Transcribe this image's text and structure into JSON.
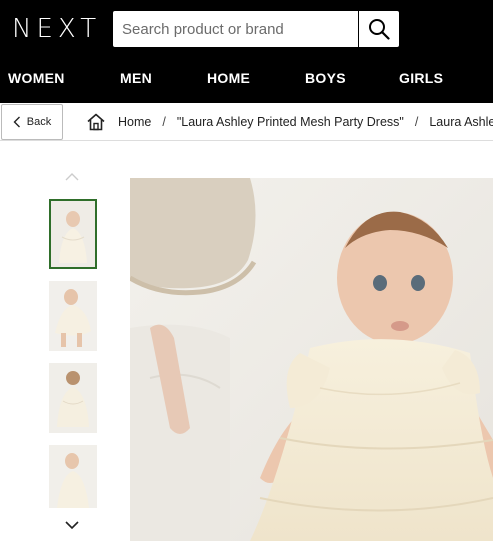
{
  "header": {
    "logo_text": "NEXT",
    "search_placeholder": "Search product or brand"
  },
  "nav": {
    "items": [
      {
        "label": "WOMEN"
      },
      {
        "label": "MEN"
      },
      {
        "label": "HOME"
      },
      {
        "label": "BOYS"
      },
      {
        "label": "GIRLS"
      }
    ]
  },
  "breadcrumb": {
    "back_label": "Back",
    "items": [
      {
        "label": "Home"
      },
      {
        "label": "\"Laura Ashley Printed Mesh Party Dress\""
      },
      {
        "label": "Laura Ashley"
      }
    ]
  },
  "gallery": {
    "thumbnail_count": 4,
    "selected_index": 0
  },
  "colors": {
    "header_bg": "#000000",
    "selected_thumb_border": "#2f6e2a"
  },
  "icons": [
    "search-icon",
    "chevron-left-icon",
    "home-icon",
    "chevron-up-icon",
    "chevron-down-icon"
  ]
}
